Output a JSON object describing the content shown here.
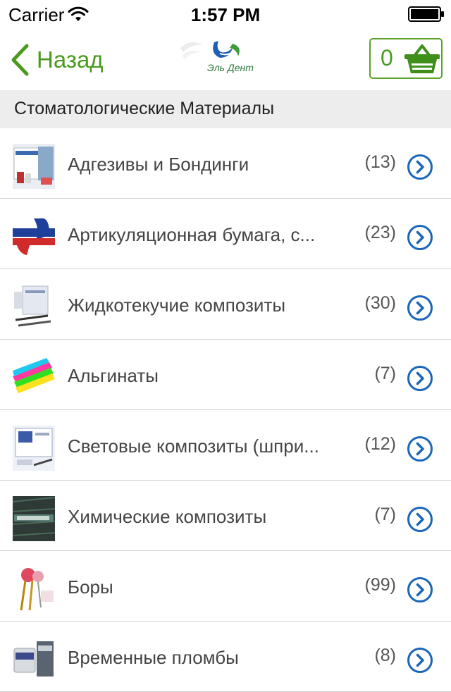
{
  "status_bar": {
    "carrier": "Carrier",
    "time": "1:57 PM"
  },
  "nav": {
    "back_label": "Назад",
    "logo_text": "Эль Дент",
    "cart_count": "0"
  },
  "section": {
    "title": "Стоматологические Материалы"
  },
  "items": [
    {
      "title": "Адгезивы и Бондинги",
      "count": "(13)",
      "thumb": "adhesives-thumbnail"
    },
    {
      "title": "Артикуляционная бумага, с...",
      "count": "(23)",
      "thumb": "articulating-paper-thumbnail"
    },
    {
      "title": "Жидкотекучие композиты",
      "count": "(30)",
      "thumb": "flowable-composites-thumbnail"
    },
    {
      "title": "Альгинаты",
      "count": "(7)",
      "thumb": "alginates-thumbnail"
    },
    {
      "title": "Световые композиты (шпри...",
      "count": "(12)",
      "thumb": "light-cure-composites-thumbnail"
    },
    {
      "title": "Химические композиты",
      "count": "(7)",
      "thumb": "chemical-composites-thumbnail"
    },
    {
      "title": "Боры",
      "count": "(99)",
      "thumb": "burs-thumbnail"
    },
    {
      "title": "Временные пломбы",
      "count": "(8)",
      "thumb": "temporary-fillings-thumbnail"
    }
  ],
  "colors": {
    "accent": "#4a9a1e",
    "disclosure": "#1a66b8",
    "section_bg": "#ededed"
  },
  "icons": [
    "wifi-icon",
    "battery-icon",
    "back-chevron-icon",
    "basket-icon",
    "disclosure-icon"
  ]
}
